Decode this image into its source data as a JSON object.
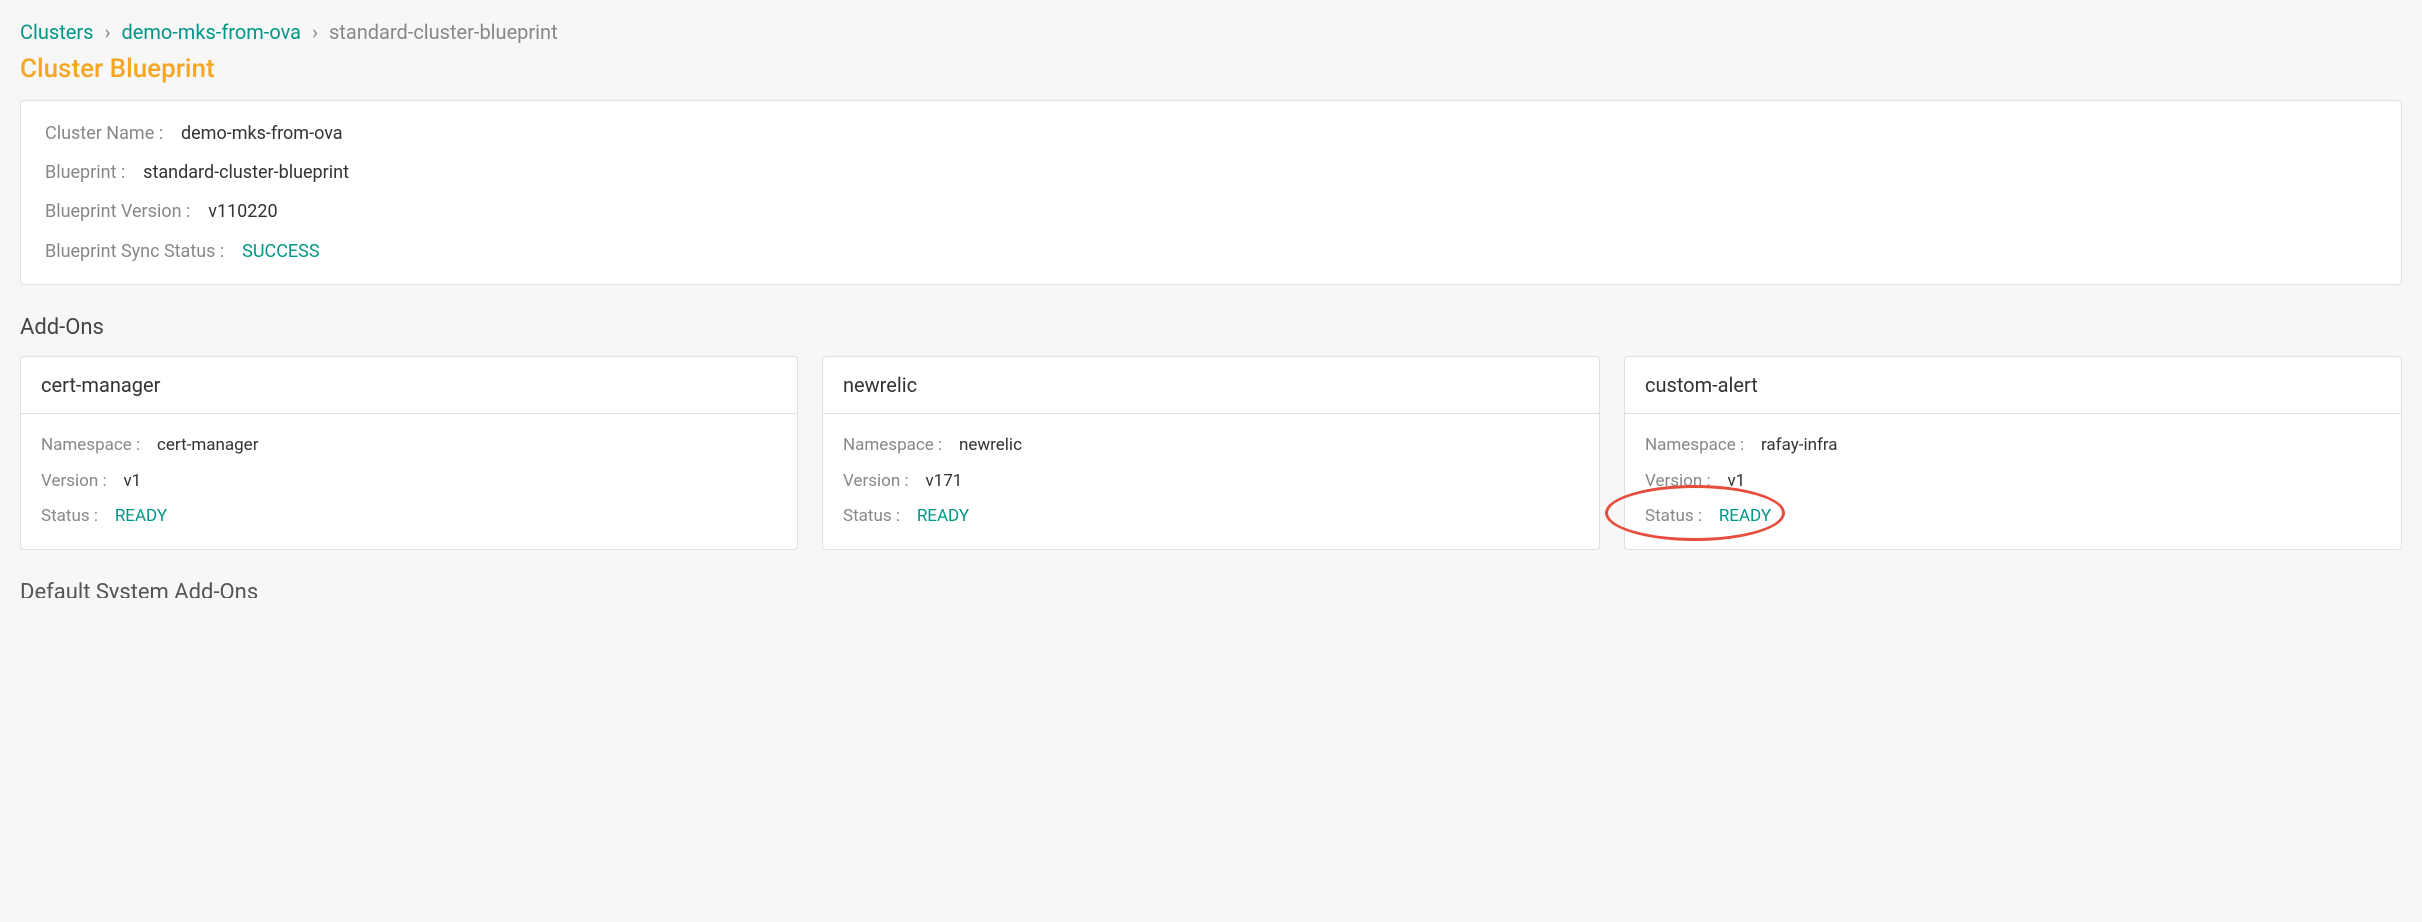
{
  "breadcrumb": {
    "items": [
      {
        "label": "Clusters",
        "link": true
      },
      {
        "label": "demo-mks-from-ova",
        "link": true
      },
      {
        "label": "standard-cluster-blueprint",
        "link": false
      }
    ],
    "separator": "›"
  },
  "page_title": "Cluster Blueprint",
  "summary": {
    "cluster_name_label": "Cluster Name :",
    "cluster_name_value": "demo-mks-from-ova",
    "blueprint_label": "Blueprint :",
    "blueprint_value": "standard-cluster-blueprint",
    "blueprint_version_label": "Blueprint Version :",
    "blueprint_version_value": "v110220",
    "sync_status_label": "Blueprint Sync Status :",
    "sync_status_value": "SUCCESS"
  },
  "addons_section_title": "Add-Ons",
  "addons": [
    {
      "title": "cert-manager",
      "namespace_label": "Namespace :",
      "namespace_value": "cert-manager",
      "version_label": "Version :",
      "version_value": "v1",
      "status_label": "Status :",
      "status_value": "READY"
    },
    {
      "title": "newrelic",
      "namespace_label": "Namespace :",
      "namespace_value": "newrelic",
      "version_label": "Version :",
      "version_value": "v171",
      "status_label": "Status :",
      "status_value": "READY"
    },
    {
      "title": "custom-alert",
      "namespace_label": "Namespace :",
      "namespace_value": "rafay-infra",
      "version_label": "Version :",
      "version_value": "v1",
      "status_label": "Status :",
      "status_value": "READY"
    }
  ],
  "default_section_title": "Default System Add-Ons"
}
